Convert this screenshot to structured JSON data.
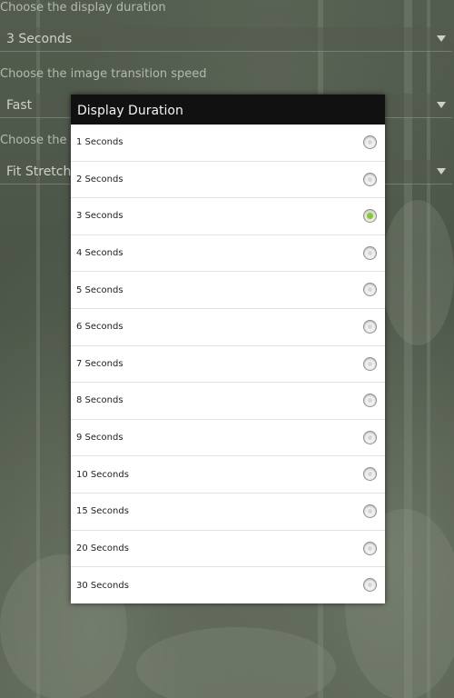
{
  "settings": {
    "display_duration": {
      "label": "Choose the display duration",
      "value": "3 Seconds"
    },
    "transition_speed": {
      "label": "Choose the image transition speed",
      "value": "Fast"
    },
    "image_mode": {
      "label": "Choose the im",
      "value": "Fit Stretch"
    }
  },
  "dialog": {
    "title": "Display Duration",
    "options": [
      {
        "label": "1 Seconds",
        "checked": false
      },
      {
        "label": "2 Seconds",
        "checked": false
      },
      {
        "label": "3 Seconds",
        "checked": true
      },
      {
        "label": "4 Seconds",
        "checked": false
      },
      {
        "label": "5 Seconds",
        "checked": false
      },
      {
        "label": "6 Seconds",
        "checked": false
      },
      {
        "label": "7 Seconds",
        "checked": false
      },
      {
        "label": "8 Seconds",
        "checked": false
      },
      {
        "label": "9 Seconds",
        "checked": false
      },
      {
        "label": "10 Seconds",
        "checked": false
      },
      {
        "label": "15 Seconds",
        "checked": false
      },
      {
        "label": "20 Seconds",
        "checked": false
      },
      {
        "label": "30 Seconds",
        "checked": false
      }
    ]
  },
  "colors": {
    "selected_radio": "#8cc63f",
    "dialog_title_bar": "#111111"
  }
}
